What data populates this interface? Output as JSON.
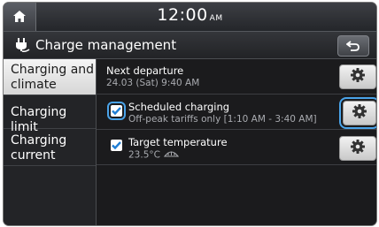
{
  "status": {
    "time": "12:00",
    "ampm": "AM"
  },
  "header": {
    "title": "Charge management"
  },
  "menu": {
    "items": [
      {
        "line1": "Charging and",
        "line2": "climate",
        "active": true
      },
      {
        "line1": "Charging limit",
        "line2": ""
      },
      {
        "line1": "Charging",
        "line2": "current"
      }
    ]
  },
  "content": {
    "departure": {
      "label": "Next departure",
      "value": "24.03 (Sat) 9:40 AM"
    },
    "scheduled": {
      "label": "Scheduled charging",
      "value": "Off-peak tariffs only [1:10 AM - 3:40 AM]",
      "checked": true
    },
    "temperature": {
      "label": "Target temperature",
      "value": "23.5°C",
      "checked": true
    }
  },
  "colors": {
    "accent": "#4aa3e8",
    "background": "#1b1b1d",
    "active_menu": "#e6e6e6"
  }
}
